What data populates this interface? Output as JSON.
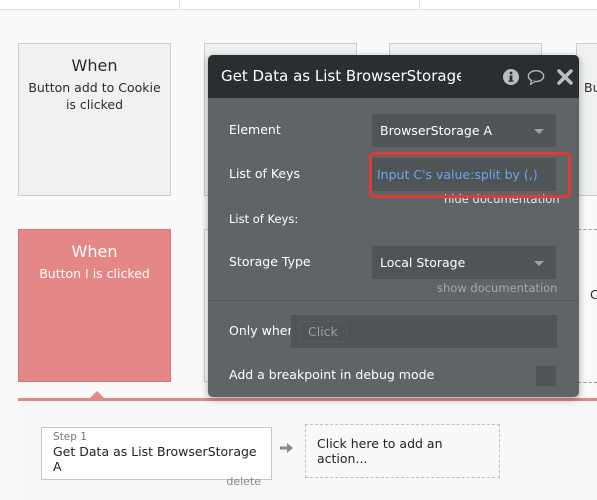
{
  "events": [
    {
      "when": "When",
      "description": "Button add to Cookie is clicked",
      "active": false
    },
    {
      "when": "When",
      "description": "Button I is clicked",
      "active": true
    }
  ],
  "partial_texts": {
    "right_card_top": "Bu",
    "right_card_mid": "C"
  },
  "modal": {
    "title": "Get Data as List BrowserStorage A",
    "icons": {
      "info": "info-icon",
      "comment": "comment-icon",
      "close": "close-icon"
    },
    "rows": {
      "element": {
        "label": "Element",
        "value": "BrowserStorage A"
      },
      "list_of_keys": {
        "label": "List of Keys",
        "value": "Input C's value:split by (,)"
      },
      "hide_documentation": "hide documentation",
      "list_of_keys_doc": "List of Keys:",
      "storage_type": {
        "label": "Storage Type",
        "value": "Local Storage"
      },
      "show_documentation": "show documentation",
      "only_when": {
        "label": "Only when",
        "placeholder": "Click"
      },
      "breakpoint": {
        "label": "Add a breakpoint in debug mode",
        "checked": false
      }
    }
  },
  "actions": {
    "step": {
      "label": "Step 1",
      "title": "Get Data as List BrowserStorage A",
      "delete": "delete"
    },
    "add_action": "Click here to add an action..."
  },
  "colors": {
    "active_event": "#e68787",
    "modal_bg": "#5f6468",
    "modal_header": "#2a2e30",
    "dynamic_text": "#6aa6f2",
    "highlight": "#e23b35"
  }
}
